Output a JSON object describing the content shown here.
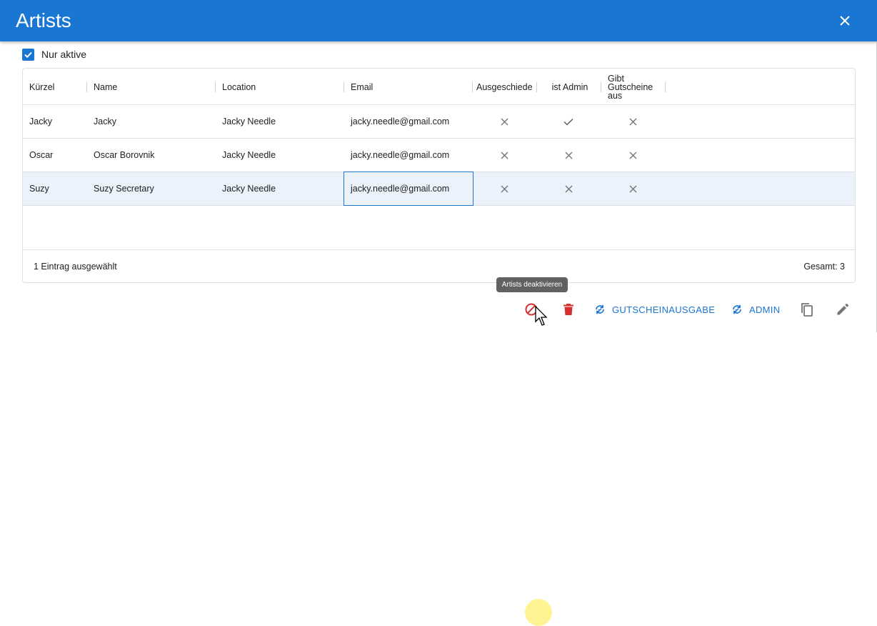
{
  "dialog": {
    "title": "Artists",
    "close_icon": "close-icon"
  },
  "filter": {
    "label": "Nur aktive",
    "checked": true
  },
  "table": {
    "columns": [
      {
        "key": "kuerzel",
        "label": "Kürzel"
      },
      {
        "key": "name",
        "label": "Name"
      },
      {
        "key": "location",
        "label": "Location"
      },
      {
        "key": "email",
        "label": "Email"
      },
      {
        "key": "ausgeschieden",
        "label": "Ausgeschiede"
      },
      {
        "key": "admin",
        "label": "ist Admin"
      },
      {
        "key": "gutscheine",
        "label": "Gibt Gutscheine aus"
      }
    ],
    "rows": [
      {
        "kuerzel": "Jacky",
        "name": "Jacky",
        "location": "Jacky Needle",
        "email": "jacky.needle@gmail.com",
        "ausgeschieden": "no",
        "admin": "yes",
        "gutscheine": "no",
        "selected": false
      },
      {
        "kuerzel": "Oscar",
        "name": "Oscar Borovnik",
        "location": "Jacky Needle",
        "email": "jacky.needle@gmail.com",
        "ausgeschieden": "no",
        "admin": "no",
        "gutscheine": "no",
        "selected": false
      },
      {
        "kuerzel": "Suzy",
        "name": "Suzy Secretary",
        "location": "Jacky Needle",
        "email": "jacky.needle@gmail.com",
        "ausgeschieden": "no",
        "admin": "no",
        "gutscheine": "no",
        "selected": true
      }
    ],
    "footer": {
      "selection_text": "1 Eintrag ausgewählt",
      "total_text": "Gesamt: 3"
    }
  },
  "tooltip": {
    "text": "Artists deaktivieren"
  },
  "actions": {
    "deactivate_icon": "block-icon",
    "delete_icon": "trash-icon",
    "gutscheinausgabe_label": "GUTSCHEINAUSGABE",
    "admin_label": "ADMIN",
    "copy_icon": "copy-icon",
    "edit_icon": "pencil-icon"
  },
  "colors": {
    "primary": "#1976d2",
    "delete": "#d32f2f",
    "selected_row": "#ebf2fb",
    "icon_gray": "#757575"
  }
}
